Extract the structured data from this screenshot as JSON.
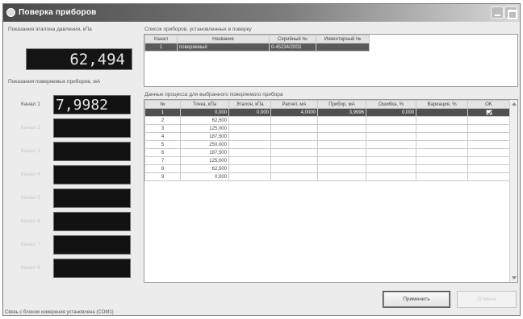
{
  "window": {
    "title": "Поверка приборов"
  },
  "left": {
    "pressure_label": "Показания эталона давления, кПа",
    "pressure_value": "62,494",
    "devices_label": "Показания поверяемых приборов, мА",
    "channels": [
      {
        "label": "Канал 1",
        "value": "7,9982",
        "active": true
      },
      {
        "label": "Канал 2",
        "value": "",
        "active": false
      },
      {
        "label": "Канал 3",
        "value": "",
        "active": false
      },
      {
        "label": "Канал 4",
        "value": "",
        "active": false
      },
      {
        "label": "Канал 5",
        "value": "",
        "active": false
      },
      {
        "label": "Канал 6",
        "value": "",
        "active": false
      },
      {
        "label": "Канал 7",
        "value": "",
        "active": false
      },
      {
        "label": "Канал 8",
        "value": "",
        "active": false
      }
    ]
  },
  "devices": {
    "caption": "Список приборов, установленных в поверку",
    "headers": [
      "Канал",
      "Название",
      "Серийный №",
      "Инвентарный №"
    ],
    "rows": [
      {
        "channel": "1",
        "name": "поверяемый",
        "serial": "0-45234/2003",
        "inventory": ""
      }
    ]
  },
  "measurements": {
    "caption": "Данные процесса для выбранного поверяемого прибора",
    "headers": [
      "№",
      "Точка, кПа",
      "Эталон, кПа",
      "Расчет, мА",
      "Прибор, мА",
      "Ошибка, %",
      "Вариация, %",
      "OK"
    ],
    "rows": [
      {
        "n": "1",
        "point": "0,000",
        "ref": "0,000",
        "calc": "4,0000",
        "device": "3,9996",
        "err": "0,000",
        "var": "",
        "ok": true
      },
      {
        "n": "2",
        "point": "62,500",
        "ref": "",
        "calc": "",
        "device": "",
        "err": "",
        "var": "",
        "ok": false
      },
      {
        "n": "3",
        "point": "125,000",
        "ref": "",
        "calc": "",
        "device": "",
        "err": "",
        "var": "",
        "ok": false
      },
      {
        "n": "4",
        "point": "187,500",
        "ref": "",
        "calc": "",
        "device": "",
        "err": "",
        "var": "",
        "ok": false
      },
      {
        "n": "5",
        "point": "250,000",
        "ref": "",
        "calc": "",
        "device": "",
        "err": "",
        "var": "",
        "ok": false
      },
      {
        "n": "6",
        "point": "187,500",
        "ref": "",
        "calc": "",
        "device": "",
        "err": "",
        "var": "",
        "ok": false
      },
      {
        "n": "7",
        "point": "125,000",
        "ref": "",
        "calc": "",
        "device": "",
        "err": "",
        "var": "",
        "ok": false
      },
      {
        "n": "8",
        "point": "62,500",
        "ref": "",
        "calc": "",
        "device": "",
        "err": "",
        "var": "",
        "ok": false
      },
      {
        "n": "9",
        "point": "0,000",
        "ref": "",
        "calc": "",
        "device": "",
        "err": "",
        "var": "",
        "ok": false
      }
    ]
  },
  "buttons": {
    "apply": "Применить",
    "cancel": "Отмена"
  },
  "status": {
    "text": "Связь с блоком измерения установлена (COM1)"
  },
  "colors": {
    "titlebar_dark": "#4a4a4a",
    "lcd_background": "#141414",
    "selected_row": "#505050"
  }
}
